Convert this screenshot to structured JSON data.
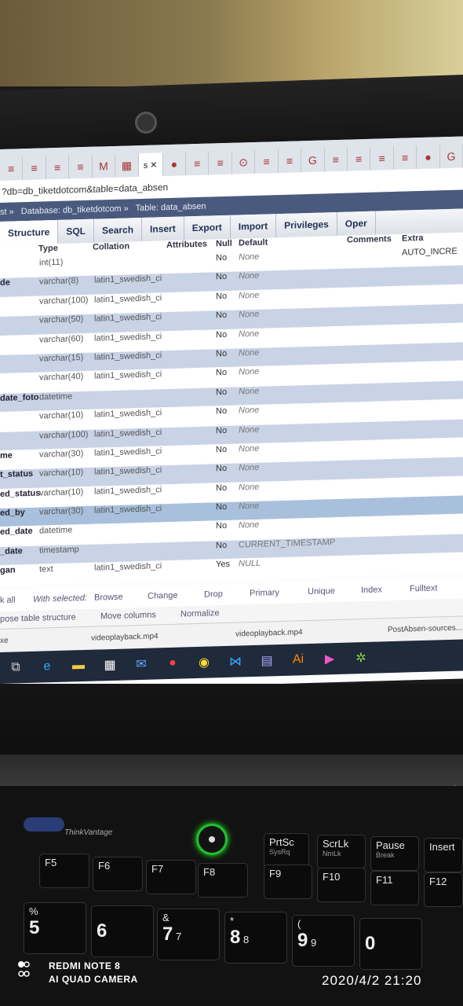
{
  "browser": {
    "tabs": [
      "≡",
      "≡",
      "≡",
      "≡",
      "M",
      "▦",
      "s ✕",
      "●",
      "≡",
      "≡",
      "⊙",
      "≡",
      "≡",
      "G",
      "≡",
      "≡",
      "≡",
      "≡",
      "●",
      "G"
    ],
    "url": "?db=db_tiketdotcom&table=data_absen"
  },
  "breadcrumb": {
    "prefix": "st »",
    "database": "Database: db_tiketdotcom »",
    "table": "Table: data_absen"
  },
  "menu": [
    "Structure",
    "SQL",
    "Search",
    "Insert",
    "Export",
    "Import",
    "Privileges",
    "Oper"
  ],
  "columns": {
    "type": "Type",
    "collation": "Collation",
    "attributes": "Attributes",
    "null": "Null",
    "default": "Default",
    "comments": "Comments",
    "extra": "Extra"
  },
  "rows": [
    {
      "name": "",
      "type": "int(11)",
      "collation": "",
      "null": "No",
      "default": "None",
      "extra": "AUTO_INCRE"
    },
    {
      "name": "de",
      "type": "varchar(8)",
      "collation": "latin1_swedish_ci",
      "null": "No",
      "default": "None",
      "extra": ""
    },
    {
      "name": "",
      "type": "varchar(100)",
      "collation": "latin1_swedish_ci",
      "null": "No",
      "default": "None",
      "extra": ""
    },
    {
      "name": "",
      "type": "varchar(50)",
      "collation": "latin1_swedish_ci",
      "null": "No",
      "default": "None",
      "extra": ""
    },
    {
      "name": "",
      "type": "varchar(60)",
      "collation": "latin1_swedish_ci",
      "null": "No",
      "default": "None",
      "extra": ""
    },
    {
      "name": "",
      "type": "varchar(15)",
      "collation": "latin1_swedish_ci",
      "null": "No",
      "default": "None",
      "extra": ""
    },
    {
      "name": "",
      "type": "varchar(40)",
      "collation": "latin1_swedish_ci",
      "null": "No",
      "default": "None",
      "extra": ""
    },
    {
      "name": "date_foto",
      "type": "datetime",
      "collation": "",
      "null": "No",
      "default": "None",
      "extra": ""
    },
    {
      "name": "",
      "type": "varchar(10)",
      "collation": "latin1_swedish_ci",
      "null": "No",
      "default": "None",
      "extra": ""
    },
    {
      "name": "",
      "type": "varchar(100)",
      "collation": "latin1_swedish_ci",
      "null": "No",
      "default": "None",
      "extra": ""
    },
    {
      "name": "me",
      "type": "varchar(30)",
      "collation": "latin1_swedish_ci",
      "null": "No",
      "default": "None",
      "extra": ""
    },
    {
      "name": "t_status",
      "type": "varchar(10)",
      "collation": "latin1_swedish_ci",
      "null": "No",
      "default": "None",
      "extra": ""
    },
    {
      "name": "ed_status",
      "type": "varchar(10)",
      "collation": "latin1_swedish_ci",
      "null": "No",
      "default": "None",
      "extra": ""
    },
    {
      "name": "ed_by",
      "type": "varchar(30)",
      "collation": "latin1_swedish_ci",
      "null": "No",
      "default": "None",
      "extra": ""
    },
    {
      "name": "ed_date",
      "type": "datetime",
      "collation": "",
      "null": "No",
      "default": "None",
      "extra": ""
    },
    {
      "name": "_date",
      "type": "timestamp",
      "collation": "",
      "null": "No",
      "default": "CURRENT_TIMESTAMP",
      "extra": ""
    },
    {
      "name": "gan",
      "type": "text",
      "collation": "latin1_swedish_ci",
      "null": "Yes",
      "default": "NULL",
      "extra": ""
    }
  ],
  "actions": {
    "check_all": "k all",
    "with_selected": "With selected:",
    "browse": "Browse",
    "change": "Change",
    "drop": "Drop",
    "primary": "Primary",
    "unique": "Unique",
    "index": "Index",
    "fulltext": "Fulltext"
  },
  "actions2": {
    "propose": "pose table structure",
    "move": "Move columns",
    "normalize": "Normalize"
  },
  "downloads": {
    "a": "xe",
    "b": "videoplayback.mp4",
    "c": "videoplayback.mp4",
    "d": "PostAbsen-sources..."
  },
  "keyboard": {
    "thinkvantage": "ThinkVantage",
    "keys": {
      "prtsc": "PrtSc",
      "sysrq": "SysRq",
      "scrlk": "ScrLk",
      "nmlk": "NmLk",
      "pause": "Pause",
      "break": "Break",
      "insert": "Insert",
      "f5": "F5",
      "f6": "F6",
      "f7": "F7",
      "f8": "F8",
      "f9": "F9",
      "f10": "F10",
      "f11": "F11",
      "f12": "F12",
      "pct": "%",
      "n5": "5",
      "n6": "6",
      "amp": "&",
      "n7": "7",
      "n7b": "7",
      "star": "*",
      "n8": "8",
      "n8b": "8",
      "paren": "(",
      "n9": "9",
      "n9b": "9",
      "n0": "0"
    }
  },
  "watermark": {
    "line1": "REDMI NOTE 8",
    "line2": "AI QUAD CAMERA",
    "timestamp": "2020/4/2  21:20"
  },
  "colors": {
    "power_led": "#22c032",
    "header_bar": "#4a5a7e",
    "row_alt": "#c9d3e6"
  }
}
